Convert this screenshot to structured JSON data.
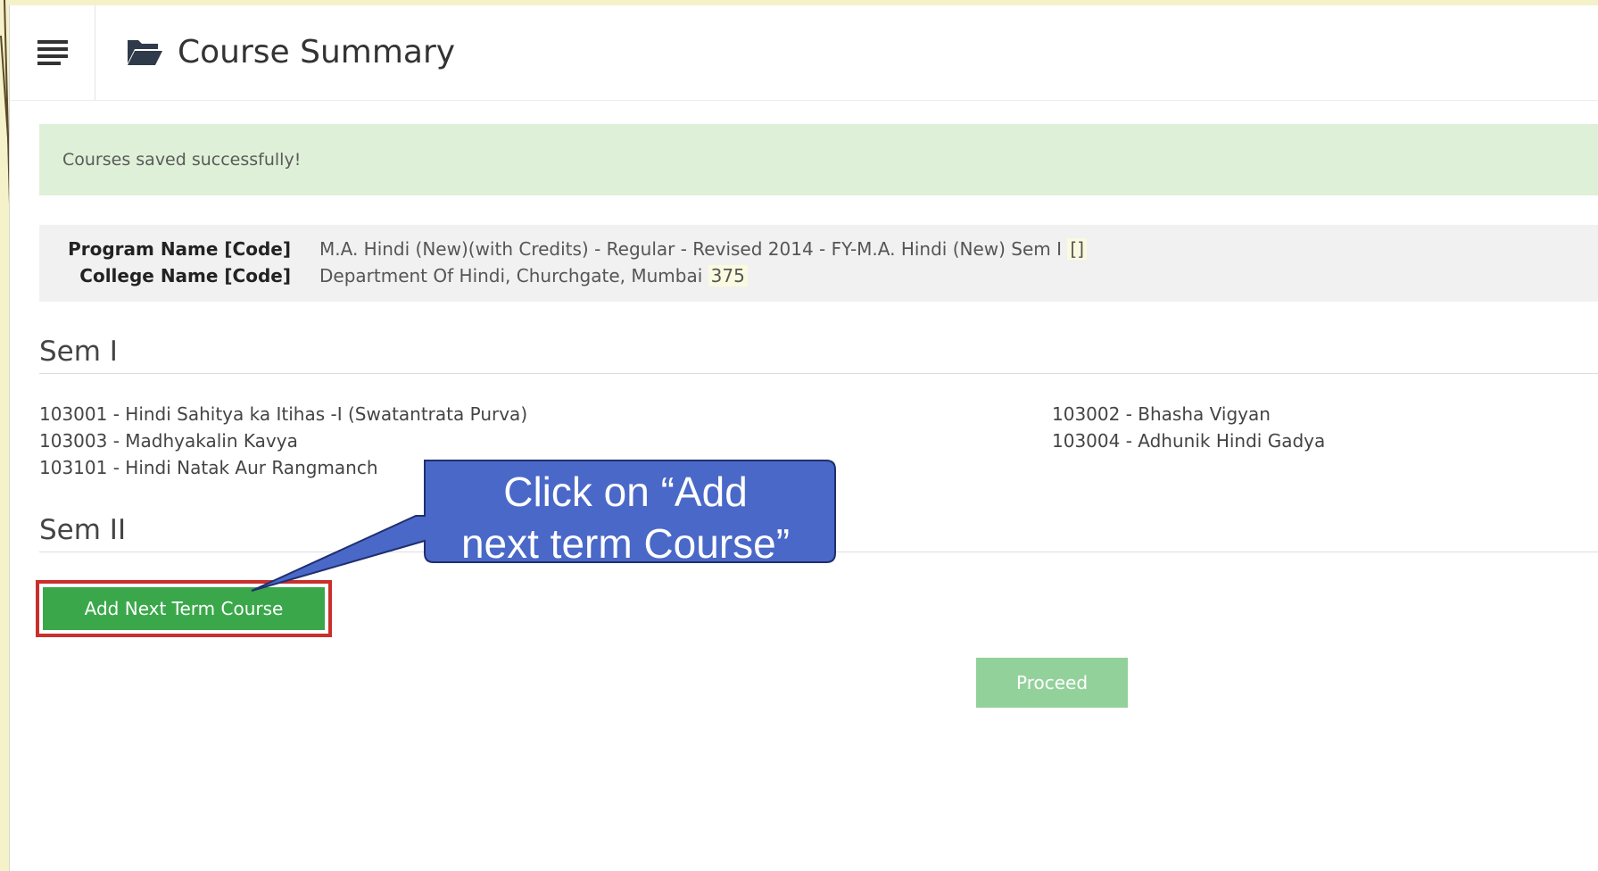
{
  "header": {
    "title": "Course Summary",
    "menu_icon": "hamburger-icon",
    "title_icon": "folder-open-icon"
  },
  "alert": {
    "message": "Courses saved successfully!"
  },
  "info": {
    "program_label": "Program Name [Code]",
    "program_value": "M.A. Hindi (New)(with Credits) - Regular - Revised 2014 - FY-M.A. Hindi (New) Sem I",
    "program_code": "[]",
    "college_label": "College Name [Code]",
    "college_value": "Department Of Hindi, Churchgate, Mumbai",
    "college_code": "375"
  },
  "sem1": {
    "heading": "Sem I",
    "courses_left": [
      "103001 - Hindi Sahitya ka Itihas -I (Swatantrata Purva)",
      "103003 - Madhyakalin Kavya",
      "103101 - Hindi Natak Aur Rangmanch"
    ],
    "courses_right": [
      "103002 - Bhasha Vigyan",
      "103004 - Adhunik Hindi Gadya"
    ]
  },
  "sem2": {
    "heading": "Sem II"
  },
  "buttons": {
    "add_next_term": "Add Next Term Course",
    "proceed": "Proceed"
  },
  "callout": {
    "line1": "Click on “Add",
    "line2": "next term Course”"
  },
  "colors": {
    "success_bg": "#dff0d8",
    "add_button": "#3aa84a",
    "proceed_button": "#93d19b",
    "highlight_border": "#c9302c",
    "callout_fill": "#4a68c8"
  }
}
